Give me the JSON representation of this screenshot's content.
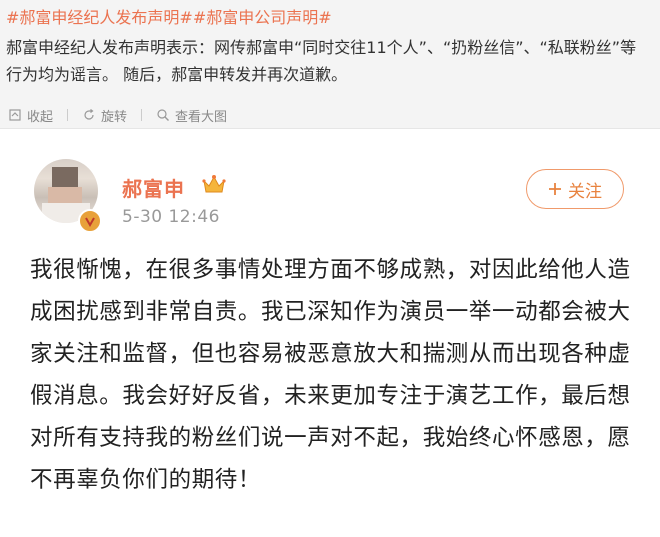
{
  "header": {
    "tags": [
      "#郝富申经纪人发布声明#",
      "#郝富申公司声明#"
    ],
    "intro": "郝富申经纪人发布声明表示：网传郝富申“同时交往11个人”、“扔粉丝信”、“私联粉丝”等行为均为谣言。 随后，郝富申转发并再次道歉。"
  },
  "actions": {
    "collapse_label": "收起",
    "rotate_label": "旋转",
    "view_large_label": "查看大图"
  },
  "post": {
    "username": "郝富申",
    "timestamp": "5-30 12:46",
    "follow_label": "关注",
    "content": "我很惭愧，在很多事情处理方面不够成熟，对因此给他人造成困扰感到非常自责。我已深知作为演员一举一动都会被大家关注和监督，但也容易被恶意放大和揣测从而出现各种虚假消息。我会好好反省，未来更加专注于演艺工作，最后想对所有支持我的粉丝们说一声对不起，我始终心怀感恩，愿不再辜负你们的期待！"
  },
  "colors": {
    "accent": "#eb7350",
    "follow_border": "#f09a6b",
    "muted": "#999999"
  },
  "icons": [
    "collapse-icon",
    "rotate-icon",
    "view-large-icon",
    "verified-badge-icon",
    "crown-icon",
    "plus-icon"
  ]
}
